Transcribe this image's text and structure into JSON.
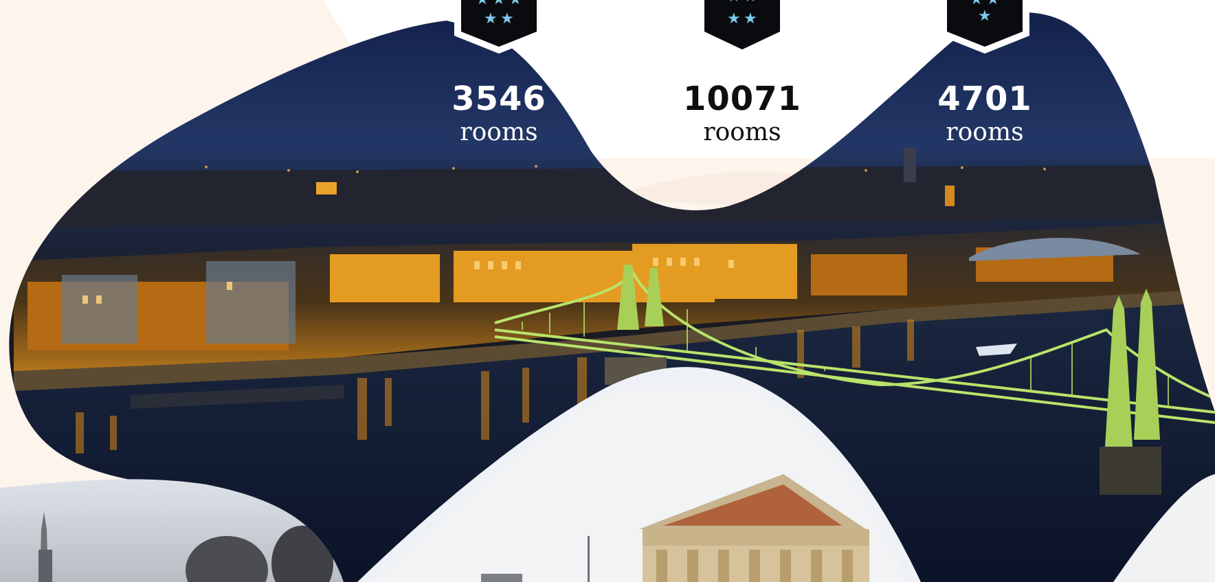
{
  "stats": [
    {
      "stars": 5,
      "number": "3546",
      "unit": "rooms"
    },
    {
      "stars": 4,
      "number": "10071",
      "unit": "rooms"
    },
    {
      "stars": 3,
      "number": "4701",
      "unit": "rooms"
    }
  ],
  "colors": {
    "background": "#fdf4ec",
    "badge": "#0a0b0e",
    "star": "#7fc7ee",
    "night_sky": "#1f3463",
    "river": "#0f1a33",
    "bridge": "#b9e36a",
    "city_lights": "#f3a21b"
  }
}
